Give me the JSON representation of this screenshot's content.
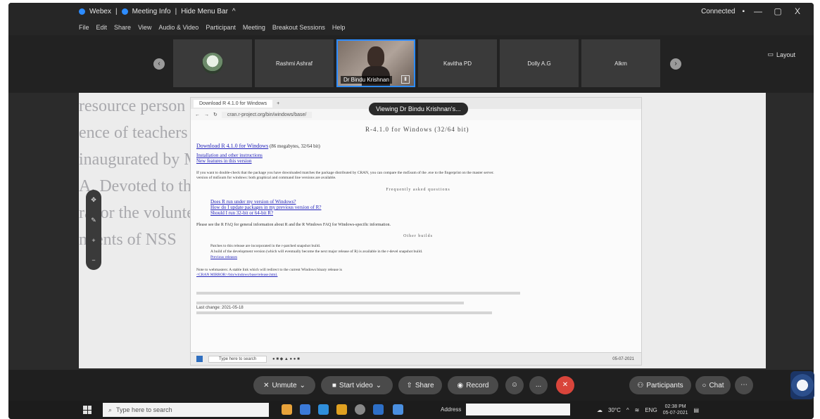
{
  "titlebar": {
    "app": "Webex",
    "meeting_info": "Meeting Info",
    "hide_menu": "Hide Menu Bar",
    "status": "Connected",
    "minimize": "—",
    "maximize": "▢",
    "close": "X"
  },
  "menu": [
    "File",
    "Edit",
    "Share",
    "View",
    "Audio & Video",
    "Participant",
    "Meeting",
    "Breakout Sessions",
    "Help"
  ],
  "participants": [
    {
      "name": ""
    },
    {
      "name": "Rashmi Ashraf"
    },
    {
      "name": "Dr Bindu Krishnan",
      "active": true
    },
    {
      "name": "Kavitha PD"
    },
    {
      "name": "Dolly A.G"
    },
    {
      "name": "Alkm"
    }
  ],
  "layout_label": "Layout",
  "viewing_label": "Viewing Dr Bindu Krishnan's...",
  "background_lines": [
    "resource person and all the participants",
    "ence of teachers and researchers. It was inaugurated",
    "inaugurated by Mr. Madhavan M, K.N. Principal, NSS College",
    "A. Devoted to the volunteers of the college. Kavitha",
    "ravor the volunteers of the college. This has",
    "ndents of NSS"
  ],
  "browser": {
    "tab_title": "Download R 4.1.0 for Windows",
    "address": "cran.r-project.org/bin/windows/base/",
    "page_title": "R-4.1.0 for Windows (32/64 bit)",
    "download_link": "Download R 4.1.0 for Windows",
    "download_suffix": "(86 megabytes, 32/64 bit)",
    "install_link": "Installation and other instructions",
    "new_features_link": "New features in this version",
    "check_line": "If you want to double-check that the package you have downloaded matches the package distributed by CRAN, you can compare the md5sum of the .exe to the fingerprint on the master server.",
    "check_line2": "version of md5sum for windows: both graphical and command line versions are available.",
    "faq_section": "Frequently asked questions",
    "faq_items": [
      "Does R run under my version of Windows?",
      "How do I update packages in my previous version of R?",
      "Should I run 32-bit or 64-bit R?"
    ],
    "rw_faq_line": "Please see the R FAQ for general information about R and the R Windows FAQ for Windows-specific information.",
    "other_section": "Other builds",
    "other_items": [
      "Patches to this release are incorporated in the r-patched snapshot build.",
      "A build of the development version (which will eventually become the next major release of R) is available in the r-devel snapshot build.",
      "Previous releases"
    ],
    "webmaster_line": "Note to webmasters: A stable link which will redirect to the current Windows binary release is",
    "webmaster_link": "<CRAN MIRROR>/bin/windows/base/release.html.",
    "last_change": "Last change: 2021-05-18",
    "inner_search": "Type here to search",
    "inner_clock": "05-07-2021"
  },
  "toolbar": {
    "unmute": "Unmute",
    "start_video": "Start video",
    "share": "Share",
    "record": "Record",
    "more": "...",
    "end": "✕",
    "participants": "Participants",
    "chat": "Chat"
  },
  "taskbar": {
    "search_placeholder": "Type here to search",
    "address_label": "Address",
    "weather": "30°C",
    "language": "ENG",
    "time": "02:38 PM",
    "date": "05-07-2021"
  },
  "colors": {
    "accent": "#2d8cff",
    "end_meeting": "#d9453b"
  }
}
